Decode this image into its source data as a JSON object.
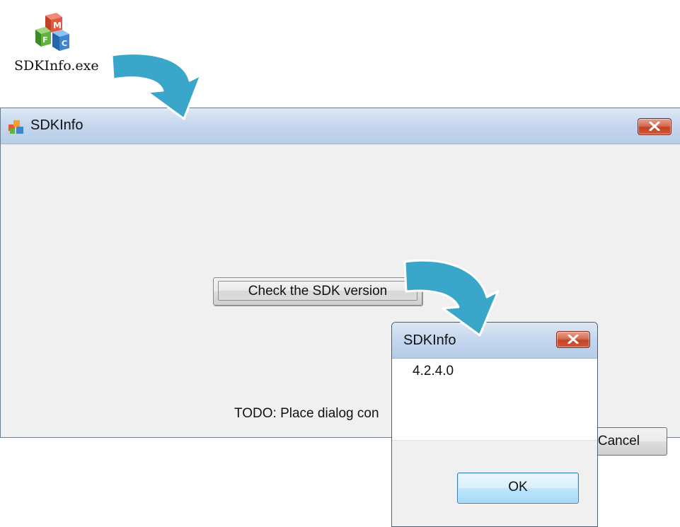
{
  "desktop_icon": {
    "label": "SDKInfo.exe",
    "icon": "mfc-app-icon"
  },
  "main_window": {
    "title": "SDKInfo",
    "icon": "app-icon",
    "check_button_label": "Check the SDK version",
    "todo_text": "TODO: Place dialog con",
    "cancel_button_label": "Cancel"
  },
  "message_box": {
    "title": "SDKInfo",
    "message": "4.2.4.0",
    "ok_button_label": "OK"
  },
  "colors": {
    "arrow": "#3aa6c9",
    "titlebar": "#c6d7ee",
    "close_button": "#c24325",
    "ok_button": "#bee6fd"
  }
}
